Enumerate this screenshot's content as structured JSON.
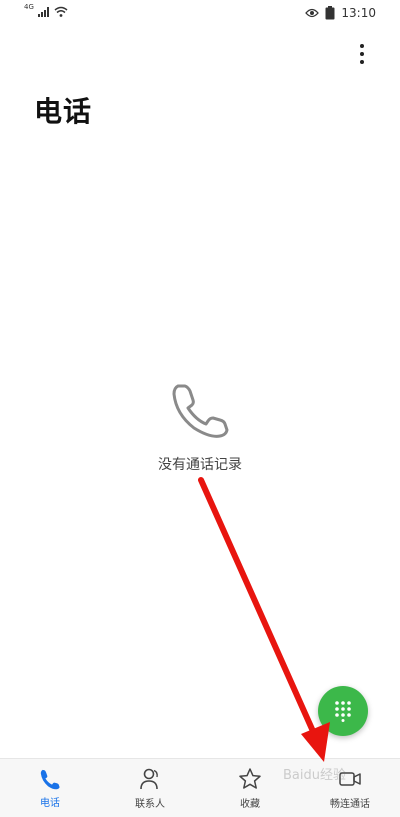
{
  "status_bar": {
    "network_label": "4G",
    "time": "13:10",
    "icons": [
      "signal-icon",
      "wifi-icon",
      "eye-icon",
      "battery-icon"
    ]
  },
  "header": {
    "title": "电话",
    "more_icon": "more-vertical-icon"
  },
  "empty_state": {
    "icon": "phone-icon",
    "message": "没有通话记录"
  },
  "fab": {
    "icon": "dialpad-icon",
    "color": "#3cb84a"
  },
  "bottom_nav": {
    "items": [
      {
        "label": "电话",
        "icon": "phone-icon",
        "active": true
      },
      {
        "label": "联系人",
        "icon": "person-icon",
        "active": false
      },
      {
        "label": "收藏",
        "icon": "star-icon",
        "active": false
      },
      {
        "label": "畅连通话",
        "icon": "video-call-icon",
        "active": false
      }
    ]
  },
  "overlay": {
    "arrow_color": "#e8150f",
    "watermark": "Baidu经验"
  },
  "colors": {
    "accent": "#1a73e8",
    "fab_green": "#3cb84a"
  }
}
